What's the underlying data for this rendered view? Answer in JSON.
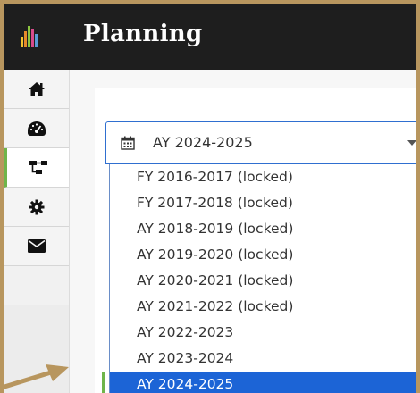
{
  "header": {
    "title": "Planning",
    "logo_icon": "bar-chart-logo-icon",
    "logo_colors": [
      "#f2c230",
      "#e58a2a",
      "#8cc63f",
      "#d94b8c",
      "#5b9bd5"
    ]
  },
  "sidebar": {
    "items": [
      {
        "icon": "home-icon",
        "active": false
      },
      {
        "icon": "dashboard-gauge-icon",
        "active": false
      },
      {
        "icon": "hierarchy-icon",
        "active": true
      },
      {
        "icon": "gear-icon",
        "active": false
      },
      {
        "icon": "envelope-icon",
        "active": false
      }
    ],
    "active_color": "#6fb54a"
  },
  "year_select": {
    "icon": "calendar-icon",
    "value": "AY 2024-2025",
    "options": [
      "FY 2016-2017 (locked)",
      "FY 2017-2018 (locked)",
      "AY 2018-2019 (locked)",
      "AY 2019-2020 (locked)",
      "AY 2020-2021 (locked)",
      "AY 2021-2022 (locked)",
      "AY 2022-2023",
      "AY 2023-2024",
      "AY 2024-2025"
    ],
    "selected_index": 8,
    "selected_color": "#1c64d6"
  },
  "annotation": {
    "arrow_icon": "pointer-arrow-icon",
    "color": "#b8965e"
  }
}
